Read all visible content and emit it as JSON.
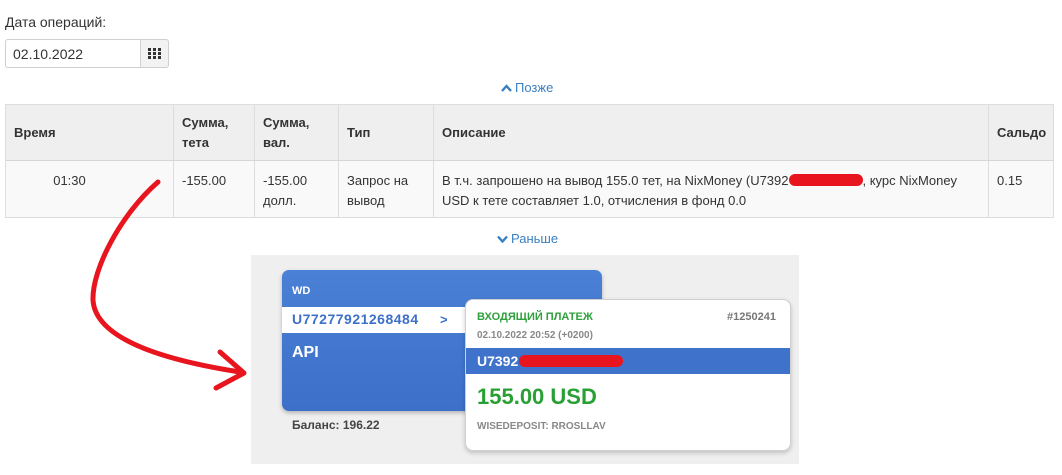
{
  "filter": {
    "date_label": "Дата операций:",
    "date_value": "02.10.2022"
  },
  "nav": {
    "later": "Позже",
    "earlier": "Раньше"
  },
  "table": {
    "headers": {
      "time": "Время",
      "sum_teta_1": "Сумма,",
      "sum_teta_2": "тета",
      "sum_cur_1": "Сумма,",
      "sum_cur_2": "вал.",
      "type": "Тип",
      "description": "Описание",
      "balance": "Сальдо"
    },
    "rows": [
      {
        "time": "01:30",
        "sum_teta": "-155.00",
        "sum_cur_1": "-155.00",
        "sum_cur_2": "долл.",
        "type_1": "Запрос на",
        "type_2": "вывод",
        "desc_part1": "В т.ч. запрошено на вывод 155.0 тет, на NixMoney (U7392",
        "desc_part2": ", курс NixMoney",
        "desc_line2": "USD к тете составляет 1.0, отчисления в фонд 0.0",
        "balance": "0.15"
      }
    ]
  },
  "screenshot": {
    "wd_title": "WD",
    "wd_account": "U77277921268484",
    "wd_arrow": ">",
    "wd_api": "API",
    "balance": "Баланс: 196.22",
    "payment": {
      "title": "ВХОДЯЩИЙ ПЛАТЕЖ",
      "number": "#1250241",
      "datetime": "02.10.2022 20:52 (+0200)",
      "account": "U7392",
      "amount": "155.00 USD",
      "memo": "WISEDEPOSIT: RROSLLAV"
    }
  },
  "colors": {
    "link": "#3a7fc1",
    "redaction": "#e8141e",
    "card_blue": "#3f73cb",
    "amount_green": "#29a034"
  }
}
